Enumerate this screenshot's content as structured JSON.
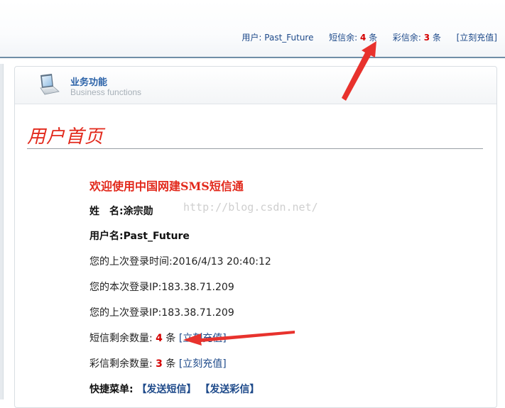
{
  "header": {
    "user_label": "用户:",
    "username": "Past_Future",
    "sms_label": "短信余:",
    "sms_count": "4",
    "sms_unit": "条",
    "mms_label": "彩信余:",
    "mms_count": "3",
    "mms_unit": "条",
    "recharge_link": "[立刻充值]"
  },
  "panel": {
    "title": "业务功能",
    "subtitle": "Business functions"
  },
  "page": {
    "title": "用户首页",
    "welcome": "欢迎使用中国网建SMS短信通",
    "watermark": "http://blog.csdn.net/",
    "name_label": "姓　名:",
    "name_value": "涂宗勋",
    "username_label": "用户名:",
    "username_value": "Past_Future",
    "last_login_time_label": "您的上次登录时间:",
    "last_login_time_value": "2016/4/13 20:40:12",
    "current_login_ip_label": "您的本次登录IP:",
    "current_login_ip_value": "183.38.71.209",
    "last_login_ip_label": "您的上次登录IP:",
    "last_login_ip_value": "183.38.71.209",
    "sms_remaining_label": "短信剩余数量:",
    "sms_remaining_count": "4",
    "sms_remaining_unit": "条",
    "sms_recharge_link": "[立刻充值]",
    "mms_remaining_label": "彩信剩余数量:",
    "mms_remaining_count": "3",
    "mms_remaining_unit": "条",
    "mms_recharge_link": "[立刻充值]",
    "quick_menu_label": "快捷菜单:",
    "send_sms_link": "【发送短信】",
    "send_mms_link": "【发送彩信】"
  },
  "colors": {
    "accent_red": "#e2291c",
    "link_blue": "#1e4a8a",
    "annotation_arrow": "#e8322d"
  },
  "icons": {
    "panel_icon": "laptop-icon"
  }
}
